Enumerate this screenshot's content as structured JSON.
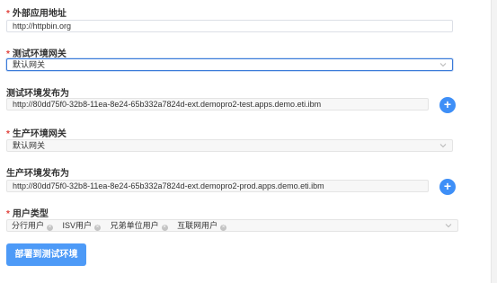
{
  "external_url": {
    "label": "外部应用地址",
    "value": "http://httpbin.org"
  },
  "test_gateway": {
    "label": "测试环境网关",
    "value": "默认网关"
  },
  "test_publish": {
    "label": "测试环境发布为",
    "value": "http://80dd75f0-32b8-11ea-8e24-65b332a7824d-ext.demopro2-test.apps.demo.eti.ibm",
    "add": "+"
  },
  "prod_gateway": {
    "label": "生产环境网关",
    "value": "默认网关"
  },
  "prod_publish": {
    "label": "生产环境发布为",
    "value": "http://80dd75f0-32b8-11ea-8e24-65b332a7824d-ext.demopro2-prod.apps.demo.eti.ibm",
    "add": "+"
  },
  "user_type": {
    "label": "用户类型",
    "tags": [
      "分行用户",
      "ISV用户",
      "兄弟单位用户",
      "互联网用户"
    ]
  },
  "deploy_button": "部署到测试环境",
  "colors": {
    "required": "#e0403a",
    "primary": "#3e8ff7",
    "focus_border": "#3a7ad9"
  }
}
